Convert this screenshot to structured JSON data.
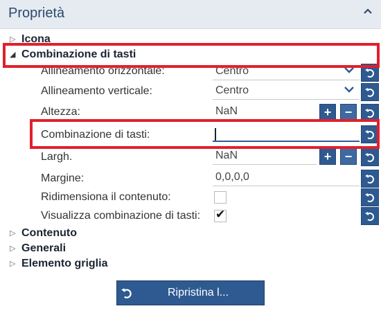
{
  "panel": {
    "title": "Proprietà"
  },
  "categories": [
    {
      "label": "Icona",
      "expanded": false
    },
    {
      "label": "Combinazione di tasti",
      "expanded": true
    },
    {
      "label": "Contenuto",
      "expanded": false
    },
    {
      "label": "Generali",
      "expanded": false
    },
    {
      "label": "Elemento griglia",
      "expanded": false
    }
  ],
  "properties": {
    "h_align": {
      "label": "Allineamento orizzontale:",
      "value": "Centro"
    },
    "v_align": {
      "label": "Allineamento verticale:",
      "value": "Centro"
    },
    "height": {
      "label": "Altezza:",
      "value": "NaN"
    },
    "shortcut": {
      "label": "Combinazione di tasti:",
      "value": ""
    },
    "width": {
      "label": "Largh.",
      "value": "NaN"
    },
    "margin": {
      "label": "Margine:",
      "value": "0,0,0,0"
    },
    "resize": {
      "label": "Ridimensiona il contenuto:",
      "checked": false
    },
    "show_shortcut": {
      "label": "Visualizza combinazione di tasti:",
      "checked": true
    }
  },
  "icons": {
    "reset": "undo-arrow-icon",
    "plus": "plus-icon",
    "minus": "minus-icon",
    "dropdown": "chevron-down-icon",
    "collapse": "chevron-up-icon"
  },
  "actions": {
    "restore_label": "Ripristina l..."
  },
  "colors": {
    "accent": "#2e5a91",
    "highlight": "#e0202c",
    "header_bg": "#e6ebf1"
  }
}
